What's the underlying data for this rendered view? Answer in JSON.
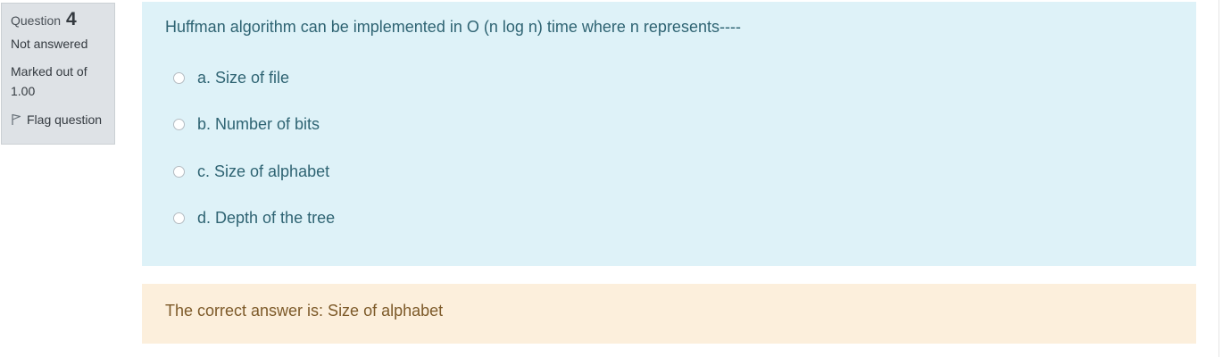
{
  "question_info": {
    "label": "Question",
    "number": "4",
    "state": "Not answered",
    "grade": "Marked out of 1.00",
    "flag_label": "Flag question"
  },
  "question": {
    "text": "Huffman algorithm can be implemented in O (n log n) time where n represents----",
    "options": [
      {
        "label": "a. Size of file"
      },
      {
        "label": "b. Number of bits"
      },
      {
        "label": "c. Size of alphabet"
      },
      {
        "label": "d. Depth of the tree"
      }
    ]
  },
  "feedback": {
    "right_answer": "The correct answer is: Size of alphabet"
  },
  "colors": {
    "question_bg": "#def2f8",
    "question_text": "#2f6473",
    "feedback_bg": "#fcefdc",
    "feedback_text": "#7d5a29",
    "info_bg": "#dee2e6"
  }
}
